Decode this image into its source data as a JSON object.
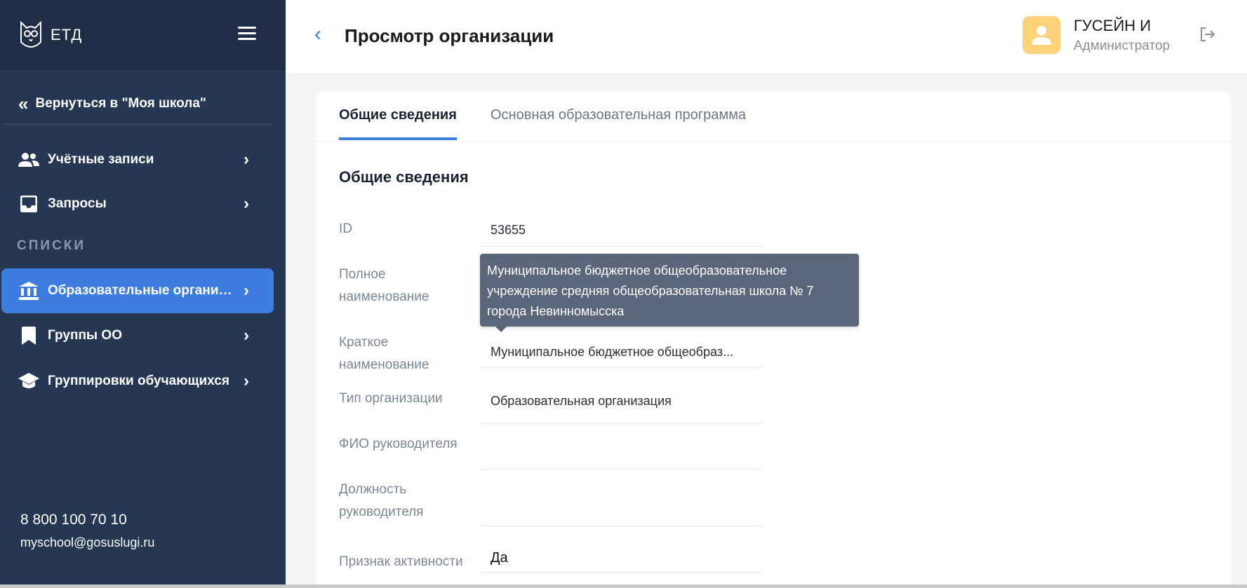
{
  "app": {
    "logo_text": "ЕТД"
  },
  "sidebar": {
    "back_label": "Вернуться в \"Моя школа\"",
    "items_top": [
      {
        "label": "Учётные записи",
        "icon": "users-icon"
      },
      {
        "label": "Запросы",
        "icon": "inbox-icon"
      }
    ],
    "section_label": "СПИСКИ",
    "items_lists": [
      {
        "label": "Образовательные организа...",
        "icon": "institution-icon",
        "active": true
      },
      {
        "label": "Группы ОО",
        "icon": "bookmark-icon"
      },
      {
        "label": "Группировки обучающихся",
        "icon": "graduation-cap-icon"
      }
    ],
    "phone": "8 800 100 70 10",
    "email": "myschool@gosuslugi.ru"
  },
  "header": {
    "title": "Просмотр организации",
    "user_name": "ГУСЕЙН И",
    "user_role": "Администратор"
  },
  "tabs": [
    {
      "label": "Общие сведения",
      "active": true
    },
    {
      "label": "Основная образовательная программа",
      "active": false
    }
  ],
  "section_title": "Общие сведения",
  "fields": {
    "id": {
      "label": "ID",
      "value": "53655"
    },
    "full_name": {
      "label_line1": "Полное",
      "label_line2": "наименование",
      "value": ""
    },
    "short_name": {
      "label_line1": "Краткое",
      "label_line2": "наименование",
      "value": "Муниципальное бюджетное общеобраз..."
    },
    "org_type": {
      "label": "Тип организации",
      "value": "Образовательная организация"
    },
    "head_name": {
      "label": "ФИО руководителя",
      "value": ""
    },
    "head_position": {
      "label_line1": "Должность",
      "label_line2": "руководителя",
      "value": ""
    },
    "active": {
      "label": "Признак активности",
      "value": "Да"
    }
  },
  "tooltip": {
    "line1": "Муниципальное бюджетное общеобразовательное",
    "line2": "учреждение средняя общеобразовательная школа № 7",
    "line3": "города Невинномысска"
  },
  "colors": {
    "sidebar_bg": "#263753",
    "accent": "#3d7de0",
    "avatar": "#ffd27a"
  }
}
